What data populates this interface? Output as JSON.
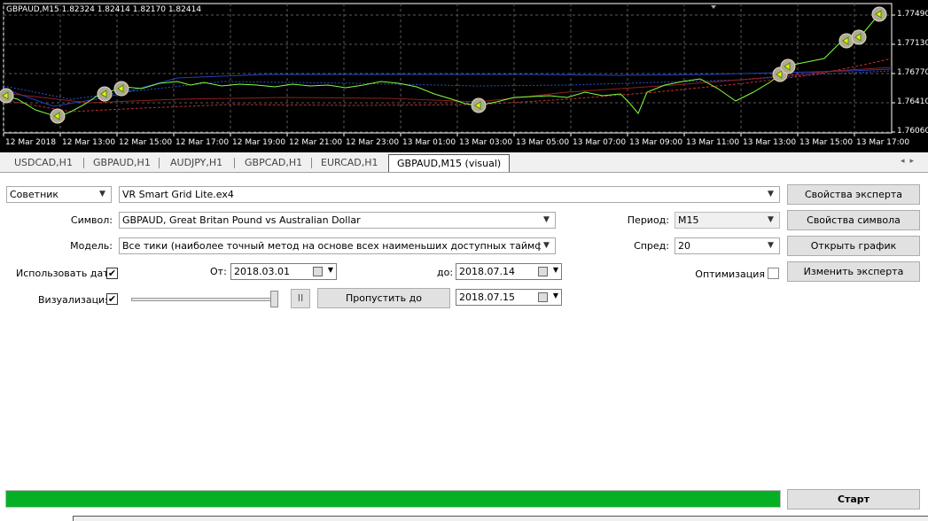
{
  "chart": {
    "info": "GBPAUD,M15  1.82324 1.82414 1.82170 1.82414",
    "price_labels": [
      "1.77490",
      "1.77130",
      "1.76770",
      "1.76410",
      "1.76060"
    ],
    "time_labels": [
      "12 Mar 2018",
      "12 Mar 13:00",
      "12 Mar 15:00",
      "12 Mar 17:00",
      "12 Mar 19:00",
      "12 Mar 21:00",
      "12 Mar 23:00",
      "13 Mar 01:00",
      "13 Mar 03:00",
      "13 Mar 05:00",
      "13 Mar 07:00",
      "13 Mar 09:00",
      "13 Mar 11:00",
      "13 Mar 13:00",
      "13 Mar 15:00",
      "13 Mar 17:00"
    ],
    "colors": {
      "background": "#000000",
      "price_line": "#7fff3f",
      "ma_red": "#c03030",
      "ma_blue": "#2040c0"
    }
  },
  "tabs": [
    "USDCAD,H1",
    "GBPAUD,H1",
    "AUDJPY,H1",
    "GBPCAD,H1",
    "EURCAD,H1",
    "GBPAUD,M15 (visual)"
  ],
  "form": {
    "type_select": "Советник",
    "expert_select": "VR Smart Grid Lite.ex4",
    "symbol_label": "Символ:",
    "symbol_value": "GBPAUD, Great Britan Pound vs Australian Dollar",
    "model_label": "Модель:",
    "model_value": "Все тики (наиболее точный метод на основе всех наименьших доступных таймфреймов для",
    "use_date_label": "Использовать дату",
    "from_label": "От:",
    "from_value": "2018.03.01",
    "to_label": "до:",
    "to_value": "2018.07.14",
    "visualization_label": "Визуализация",
    "skip_to_label": "Пропустить до",
    "skip_to_value": "2018.07.15",
    "period_label": "Период:",
    "period_value": "M15",
    "spread_label": "Спред:",
    "spread_value": "20",
    "optimization_label": "Оптимизация",
    "pause_glyph": "II",
    "check_glyph": "✔",
    "arrow_glyph": "▼"
  },
  "buttons": {
    "expert_properties": "Свойства эксперта",
    "symbol_properties": "Свойства символа",
    "open_chart": "Открыть график",
    "modify_expert": "Изменить эксперта",
    "start": "Старт"
  },
  "progress": {
    "fraction": 1.0,
    "color": "#06b025"
  },
  "icons": [
    "calendar-icon",
    "dropdown-arrow-icon",
    "pause-icon",
    "checkbox-check-icon",
    "tab-scroll-left-icon",
    "tab-scroll-right-icon"
  ]
}
